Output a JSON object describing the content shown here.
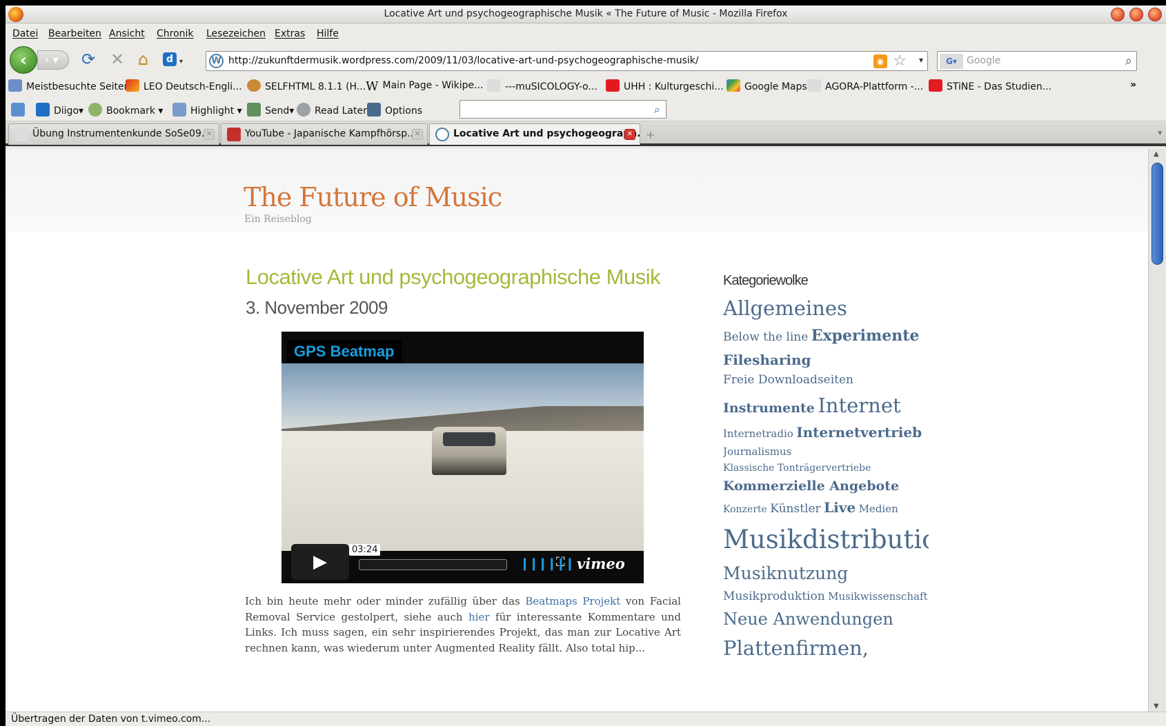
{
  "window": {
    "title": "Locative Art und psychogeographische Musik « The Future of Music - Mozilla Firefox"
  },
  "menu": [
    "Datei",
    "Bearbeiten",
    "Ansicht",
    "Chronik",
    "Lesezeichen",
    "Extras",
    "Hilfe"
  ],
  "nav": {
    "url": "http://zukunftdermusik.wordpress.com/2009/11/03/locative-art-und-psychogeographische-musik/",
    "search_placeholder": "Google"
  },
  "bookmarks": [
    "Meistbesuchte Seiten",
    "LEO Deutsch-Engli...",
    "SELFHTML 8.1.1 (H...",
    "Main Page - Wikipe...",
    "---muSICOLOGY-o...",
    "UHH : Kulturgeschi...",
    "Google Maps",
    "AGORA-Plattform -...",
    "STiNE - Das Studien...",
    "»"
  ],
  "diigo": {
    "diigo": "Diigo",
    "bookmark": "Bookmark",
    "highlight": "Highlight",
    "send": "Send",
    "read_later": "Read Later",
    "options": "Options"
  },
  "tabs": [
    {
      "label": "Übung Instrumentenkunde SoSe09..."
    },
    {
      "label": "YouTube - Japanische Kampfhörsp..."
    },
    {
      "label": "Locative Art und psychogeograph..."
    }
  ],
  "blog": {
    "title": "The Future of Music",
    "tagline": "Ein Reiseblog"
  },
  "post": {
    "title": "Locative Art und psychogeographische Musik",
    "date": "3. November 2009",
    "video": {
      "title": "GPS Beatmap",
      "time": "03:24",
      "brand": "vimeo"
    },
    "body": {
      "t1": "Ich bin heute mehr oder minder zufällig über das ",
      "link1": "Beatmaps Projekt",
      "t2": " von Facial Removal Service gestolpert, siehe auch ",
      "link2": "hier",
      "t3": " für interessante Kommentare und Links. Ich muss sagen, ein sehr inspirierendes Projekt, das man zur Locative Art rechnen kann, was wiederum unter Augmented Reality fällt. Also total hip..."
    }
  },
  "sidebar": {
    "heading": "Kategoriewolke",
    "cloud": [
      {
        "label": "Allgemeines",
        "size": 29
      },
      {
        "label": "Below the line",
        "size": 17
      },
      {
        "label": "Experimente",
        "size": 22
      },
      {
        "label": "Filesharing",
        "size": 20
      },
      {
        "label": "Freie Downloadseiten",
        "size": 17
      },
      {
        "label": "Instrumente",
        "size": 19
      },
      {
        "label": "Internet",
        "size": 29
      },
      {
        "label": "Internetradio",
        "size": 15
      },
      {
        "label": "Internetvertrieb",
        "size": 20
      },
      {
        "label": "Journalismus",
        "size": 15
      },
      {
        "label": "Klassische Tonträgervertriebe",
        "size": 14
      },
      {
        "label": "Kommerzielle Angebote",
        "size": 19
      },
      {
        "label": "Konzerte",
        "size": 14
      },
      {
        "label": "Künstler",
        "size": 17
      },
      {
        "label": "Live",
        "size": 20
      },
      {
        "label": "Medien",
        "size": 15
      },
      {
        "label": "Musikdistribution",
        "size": 37
      },
      {
        "label": "Musiknutzung",
        "size": 25
      },
      {
        "label": "Musikproduktion",
        "size": 17
      },
      {
        "label": "Musikwissenschaft",
        "size": 15
      },
      {
        "label": "Neue Anwendungen",
        "size": 24
      },
      {
        "label": "Plattenfirmen,",
        "size": 29
      }
    ]
  },
  "status": "Übertragen der Daten von t.vimeo.com..."
}
